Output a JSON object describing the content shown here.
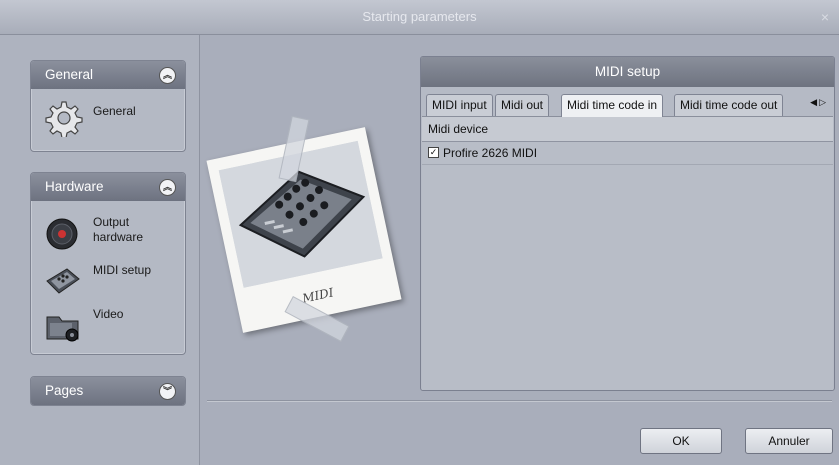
{
  "window": {
    "title": "Starting parameters",
    "close_glyph": "×"
  },
  "sidebar": {
    "general": {
      "header": "General",
      "toggle": "collapse",
      "items": [
        {
          "label": "General",
          "icon": "gear-icon"
        }
      ]
    },
    "hardware": {
      "header": "Hardware",
      "toggle": "collapse",
      "items": [
        {
          "label": "Output hardware",
          "icon": "speaker-icon"
        },
        {
          "label": "MIDI setup",
          "icon": "midi-controller-icon"
        },
        {
          "label": "Video",
          "icon": "video-folder-icon"
        }
      ]
    },
    "pages": {
      "header": "Pages",
      "toggle": "expand"
    }
  },
  "illustration": {
    "caption": "MIDI"
  },
  "midi_setup": {
    "title": "MIDI setup",
    "tabs": [
      {
        "label": "MIDI input",
        "active": false
      },
      {
        "label": "Midi out",
        "active": false
      },
      {
        "label": "Midi time code in",
        "active": true
      },
      {
        "label": "Midi time code out",
        "active": false
      }
    ],
    "column_header": "Midi device",
    "devices": [
      {
        "name": "Profire 2626 MIDI",
        "checked": true
      }
    ]
  },
  "buttons": {
    "ok": "OK",
    "cancel": "Annuler"
  }
}
